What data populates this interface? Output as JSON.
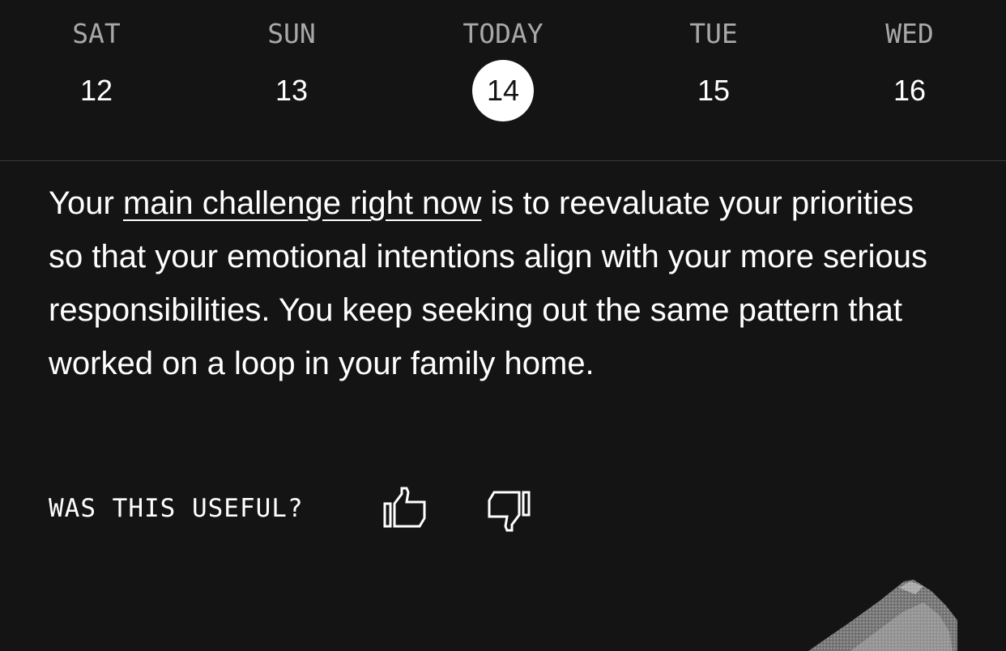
{
  "days": [
    {
      "name": "SAT",
      "number": "12",
      "selected": false
    },
    {
      "name": "SUN",
      "number": "13",
      "selected": false
    },
    {
      "name": "TODAY",
      "number": "14",
      "selected": true
    },
    {
      "name": "TUE",
      "number": "15",
      "selected": false
    },
    {
      "name": "WED",
      "number": "16",
      "selected": false
    }
  ],
  "reading": {
    "prefix": "Your ",
    "link_text": "main challenge right now",
    "suffix": " is to reevaluate your priorities so that your emotional intentions align with your more serious responsibilities. You keep seeking out the same pattern that worked on a loop in your family home."
  },
  "feedback": {
    "question": "WAS THIS USEFUL?",
    "up_icon": "thumbs-up-icon",
    "down_icon": "thumbs-down-icon"
  },
  "colors": {
    "background": "#141414",
    "text": "#ffffff",
    "muted": "#a8a8a8",
    "divider": "#3a3a3a",
    "selected_bg": "#ffffff"
  }
}
